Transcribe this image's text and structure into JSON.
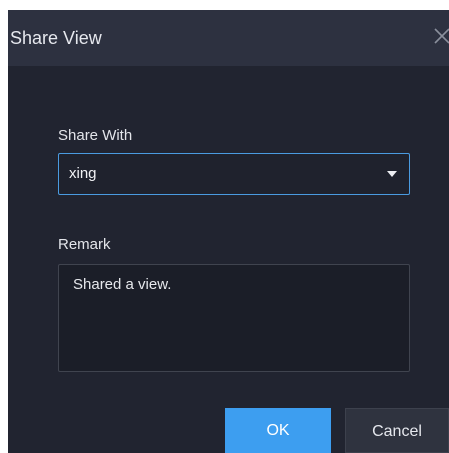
{
  "dialog": {
    "title": "Share View",
    "close_icon": "close-icon"
  },
  "share_with": {
    "label": "Share With",
    "value": "xing",
    "dropdown_icon": "caret-down-icon"
  },
  "remark": {
    "label": "Remark",
    "value": "Shared a view."
  },
  "buttons": {
    "ok_label": "OK",
    "cancel_label": "Cancel"
  },
  "colors": {
    "dialog_background": "#212430",
    "titlebar_background": "#2d3140",
    "accent": "#3d9ef0",
    "focus_border": "#4a9be0"
  }
}
